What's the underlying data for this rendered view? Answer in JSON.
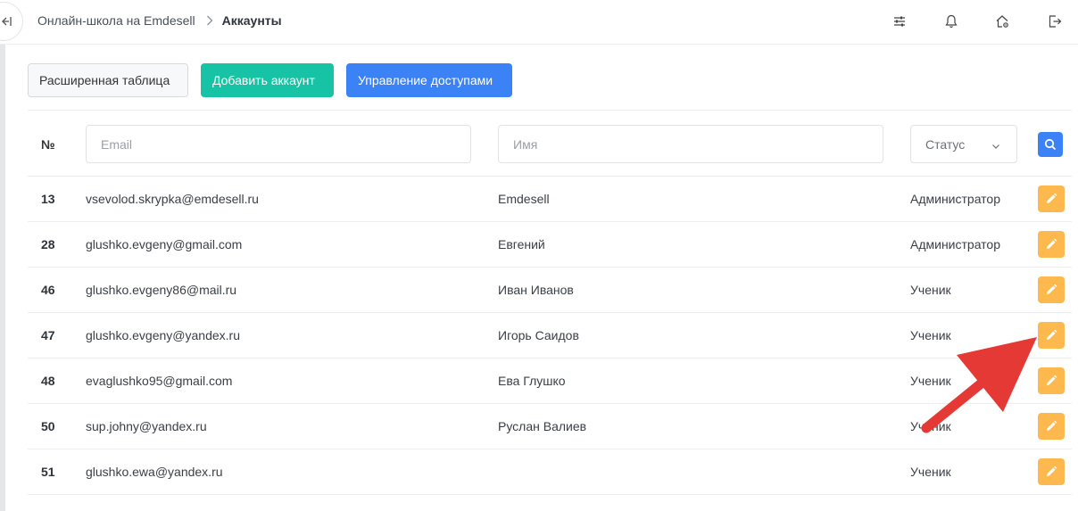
{
  "header": {
    "breadcrumb_parent": "Онлайн-школа на Emdesell",
    "breadcrumb_current": "Аккаунты",
    "icons": [
      "sliders-icon",
      "bell-icon",
      "home-gear-icon",
      "logout-icon"
    ]
  },
  "sidebar": {
    "collapse_icon": "collapse-left-icon"
  },
  "toolbar": {
    "extended_table_label": "Расширенная таблица",
    "add_account_label": "Добавить аккаунт",
    "access_management_label": "Управление доступами"
  },
  "filters": {
    "number_header": "№",
    "email_placeholder": "Email",
    "name_placeholder": "Имя",
    "status_label": "Статус",
    "search_icon": "search-icon"
  },
  "rows": [
    {
      "id": "13",
      "email": "vsevolod.skrypka@emdesell.ru",
      "name": "Emdesell",
      "status": "Администратор"
    },
    {
      "id": "28",
      "email": "glushko.evgeny@gmail.com",
      "name": "Евгений",
      "status": "Администратор"
    },
    {
      "id": "46",
      "email": "glushko.evgeny86@mail.ru",
      "name": "Иван Иванов",
      "status": "Ученик"
    },
    {
      "id": "47",
      "email": "glushko.evgeny@yandex.ru",
      "name": "Игорь Саидов",
      "status": "Ученик"
    },
    {
      "id": "48",
      "email": "evaglushko95@gmail.com",
      "name": "Ева Глушко",
      "status": "Ученик"
    },
    {
      "id": "50",
      "email": "sup.johny@yandex.ru",
      "name": "Руслан Валиев",
      "status": "Ученик"
    },
    {
      "id": "51",
      "email": "glushko.ewa@yandex.ru",
      "name": "",
      "status": "Ученик"
    }
  ],
  "colors": {
    "green_button": "#16c3a4",
    "blue_button": "#3b82f6",
    "edit_button": "#fdb84e",
    "annotation_arrow": "#e53935"
  }
}
